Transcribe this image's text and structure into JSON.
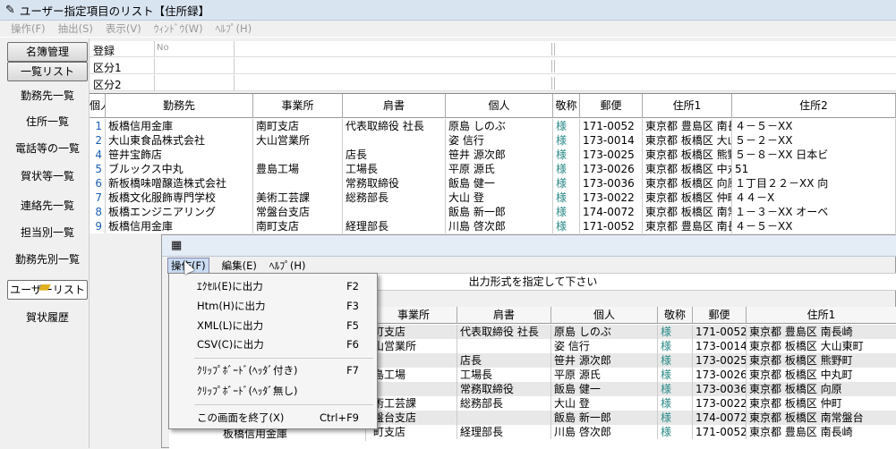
{
  "window": {
    "title": "ユーザー指定項目のリスト【住所録】"
  },
  "menubar": [
    "操作(F)",
    "抽出(S)",
    "表示(V)",
    "ｳｨﾝﾄﾞｳ(W)",
    "ﾍﾙﾌﾟ(H)"
  ],
  "sidebar": {
    "header": "名簿管理",
    "active": "一覧リスト",
    "items": [
      "勤務先一覧",
      "住所一覧",
      "電話等の一覧",
      "賀状等一覧",
      "連絡先一覧",
      "担当別一覧",
      "勤務先別一覧",
      "ユーザーリスト",
      "賀状履歴"
    ]
  },
  "filters": {
    "rows": [
      {
        "label": "登録",
        "value": "No"
      },
      {
        "label": "区分1",
        "value": ""
      },
      {
        "label": "区分2",
        "value": ""
      }
    ]
  },
  "grid": {
    "columns": [
      "個人",
      "勤務先",
      "事業所",
      "肩書",
      "個人",
      "敬称",
      "郵便",
      "住所1",
      "住所2"
    ],
    "rows": [
      [
        "1",
        "板橋信用金庫",
        "南町支店",
        "代表取締役 社長",
        "原島 しのぶ",
        "様",
        "171-0052",
        "東京都 豊島区 南長崎",
        "４－５－XX"
      ],
      [
        "2",
        "大山東食品株式会社",
        "大山営業所",
        "",
        "姿 信行",
        "様",
        "173-0014",
        "東京都 板橋区 大山東町",
        "５－２－XX"
      ],
      [
        "4",
        "笹井宝飾店",
        "",
        "店長",
        "笹井 源次郎",
        "様",
        "173-0025",
        "東京都 板橋区 熊野町",
        "５－８－XX 日本ビ"
      ],
      [
        "5",
        "ブルックス中丸",
        "豊島工場",
        "工場長",
        "平原 源氏",
        "様",
        "173-0026",
        "東京都 板橋区 中丸町",
        "51"
      ],
      [
        "6",
        "新板橋味噌醸造株式会社",
        "",
        "常務取締役",
        "飯島 健一",
        "様",
        "173-0036",
        "東京都 板橋区 向原",
        "１丁目２２－XX 向"
      ],
      [
        "7",
        "板橋文化服飾専門学校",
        "美術工芸課",
        "総務部長",
        "大山 登",
        "様",
        "173-0022",
        "東京都 板橋区 仲町",
        "４４－X"
      ],
      [
        "8",
        "板橋エンジニアリング",
        "常盤台支店",
        "",
        "飯島 新一郎",
        "様",
        "174-0072",
        "東京都 板橋区 南常盤台",
        "１－３－XX オーベ"
      ],
      [
        "9",
        "板橋信用金庫",
        "南町支店",
        "経理部長",
        "川島 啓次郎",
        "様",
        "171-0052",
        "東京都 豊島区 南長崎",
        "４－５－XX"
      ]
    ]
  },
  "subwindow": {
    "menu": [
      "操作(F)",
      "編集(E)",
      "ﾍﾙﾌﾟ(H)"
    ],
    "banner": "出力形式を指定して下さい",
    "columns": [
      "事業所",
      "肩書",
      "個人",
      "敬称",
      "郵便",
      "住所1"
    ],
    "rows": [
      [
        "町支店",
        "代表取締役 社長",
        "原島 しのぶ",
        "様",
        "171-0052",
        "東京都 豊島区 南長崎"
      ],
      [
        "山営業所",
        "",
        "姿 信行",
        "様",
        "173-0014",
        "東京都 板橋区 大山東町"
      ],
      [
        "",
        "店長",
        "笹井 源次郎",
        "様",
        "173-0025",
        "東京都 板橋区 熊野町"
      ],
      [
        "島工場",
        "工場長",
        "平原 源氏",
        "様",
        "173-0026",
        "東京都 板橋区 中丸町"
      ],
      [
        "",
        "常務取締役",
        "飯島 健一",
        "様",
        "173-0036",
        "東京都 板橋区 向原"
      ],
      [
        "術工芸課",
        "総務部長",
        "大山 登",
        "様",
        "173-0022",
        "東京都 板橋区 仲町"
      ],
      [
        "盤台支店",
        "",
        "飯島 新一郎",
        "様",
        "174-0072",
        "東京都 板橋区 南常盤台"
      ],
      [
        "町支店",
        "経理部長",
        "川島 啓次郎",
        "様",
        "171-0052",
        "東京都 豊島区 南長崎"
      ]
    ],
    "partial_last_row": "板橋信用金庫"
  },
  "dropdown": {
    "items": [
      {
        "label": "ｴｸｾﾙ(E)に出力",
        "key": "F2"
      },
      {
        "label": "Htm(H)に出力",
        "key": "F3"
      },
      {
        "label": "XML(L)に出力",
        "key": "F5"
      },
      {
        "label": "CSV(C)に出力",
        "key": "F6"
      },
      {
        "label": "ｸﾘｯﾌﾟﾎﾞｰﾄﾞ(ﾍｯﾀﾞ付き)",
        "key": "F7"
      },
      {
        "label": "ｸﾘｯﾌﾟﾎﾞｰﾄﾞ(ﾍｯﾀﾞ無し)",
        "key": ""
      },
      {
        "label": "この画面を終了(X)",
        "key": "Ctrl+F9"
      }
    ]
  },
  "colors": {
    "accent_blue": "#1a5fb4",
    "honorific_teal": "#2a8a88",
    "menu_highlight": "#c9dcf2"
  }
}
